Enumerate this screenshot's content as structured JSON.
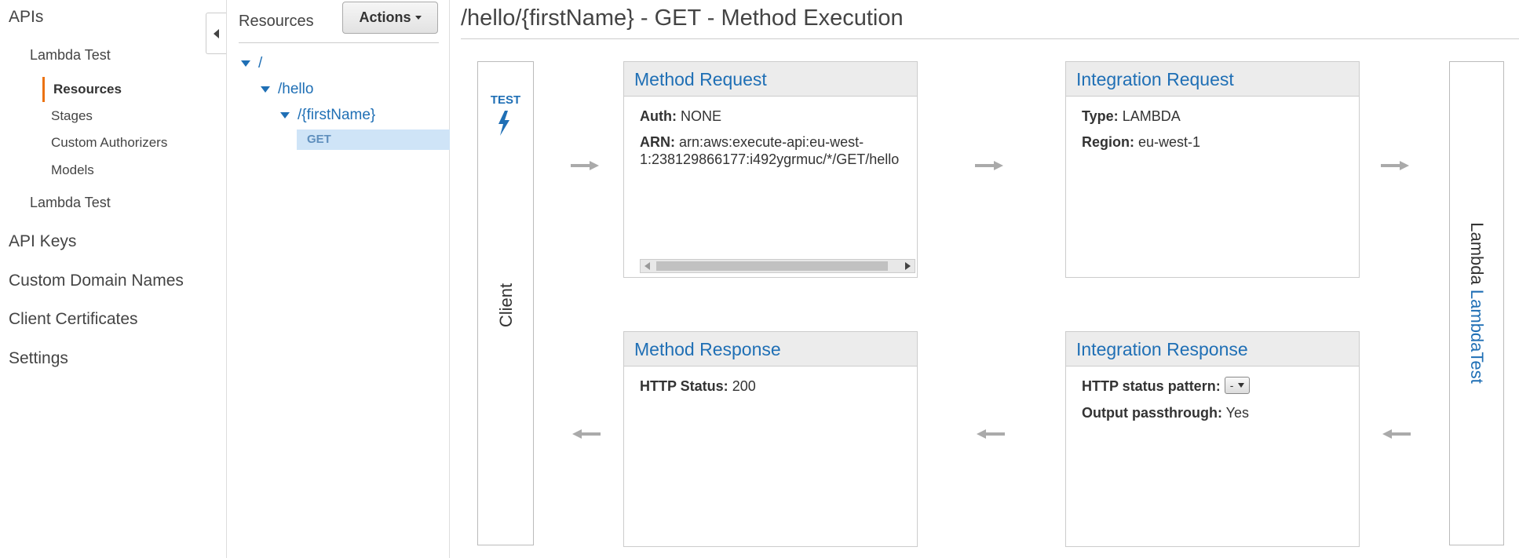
{
  "nav": {
    "apis": "APIs",
    "api_name": "Lambda Test",
    "resources": "Resources",
    "stages": "Stages",
    "custom_authorizers": "Custom Authorizers",
    "models": "Models",
    "api_name_2": "Lambda Test",
    "api_keys": "API Keys",
    "custom_domain_names": "Custom Domain Names",
    "client_certificates": "Client Certificates",
    "settings": "Settings"
  },
  "resources_panel": {
    "title": "Resources",
    "actions_label": "Actions",
    "tree": [
      {
        "label": "/"
      },
      {
        "label": "/hello"
      },
      {
        "label": "/{firstName}"
      }
    ],
    "selected_method": "GET"
  },
  "main": {
    "title": "/hello/{firstName} - GET - Method Execution",
    "client": {
      "test_label": "TEST",
      "label": "Client"
    },
    "method_request": {
      "title": "Method Request",
      "auth_label": "Auth:",
      "auth_value": "NONE",
      "arn_label": "ARN:",
      "arn_value_line1": "arn:aws:execute-api:eu-west-",
      "arn_value_line2": "1:238129866177:i492ygrmuc/*/GET/hello"
    },
    "integration_request": {
      "title": "Integration Request",
      "type_label": "Type:",
      "type_value": "LAMBDA",
      "region_label": "Region:",
      "region_value": "eu-west-1"
    },
    "method_response": {
      "title": "Method Response",
      "status_label": "HTTP Status:",
      "status_value": "200"
    },
    "integration_response": {
      "title": "Integration Response",
      "pattern_label": "HTTP status pattern:",
      "pattern_value": "-",
      "passthrough_label": "Output passthrough:",
      "passthrough_value": "Yes"
    },
    "lambda": {
      "prefix": "Lambda",
      "function_name": "LambdaTest"
    }
  },
  "colors": {
    "link": "#1f6fb5",
    "active_marker": "#ec7211",
    "selected_bg": "#cfe4f7",
    "arrow": "#aaaaaa"
  }
}
